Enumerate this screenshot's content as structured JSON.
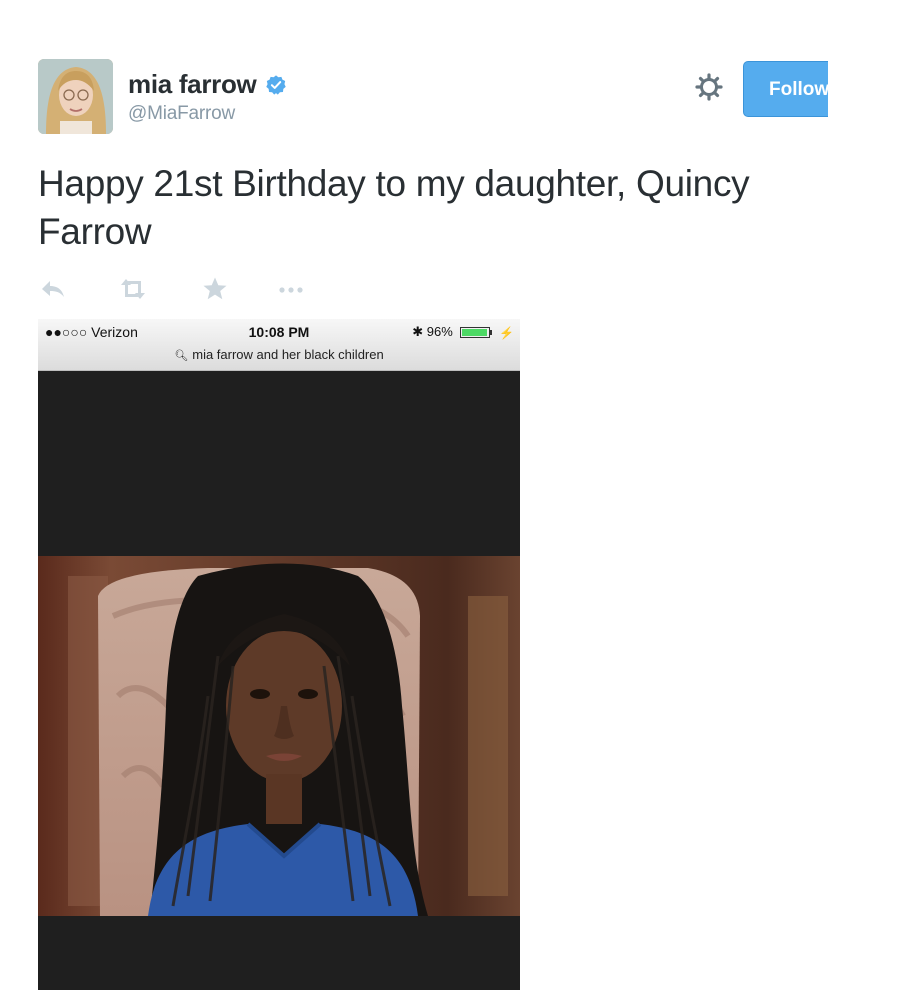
{
  "tweet": {
    "author_name": "mia farrow",
    "author_handle": "@MiaFarrow",
    "follow_label": "Follow",
    "text": "Happy 21st Birthday to my daughter, Quincy Farrow"
  },
  "icons": {
    "avatar": "avatar-photo",
    "verified": "verified-badge-icon",
    "settings": "gear-icon",
    "reply": "reply-icon",
    "retweet": "retweet-icon",
    "favorite": "star-icon",
    "more": "more-icon"
  },
  "colors": {
    "follow_button": "#55acee",
    "verified": "#55acee",
    "action_icons": "#ccd6dd",
    "handle_text": "#8899a6"
  },
  "embedded_screenshot": {
    "carrier": "●●○○○ Verizon",
    "time": "10:08 PM",
    "battery": "96%",
    "battery_level": 0.96,
    "search_query": "mia farrow and her black children"
  }
}
